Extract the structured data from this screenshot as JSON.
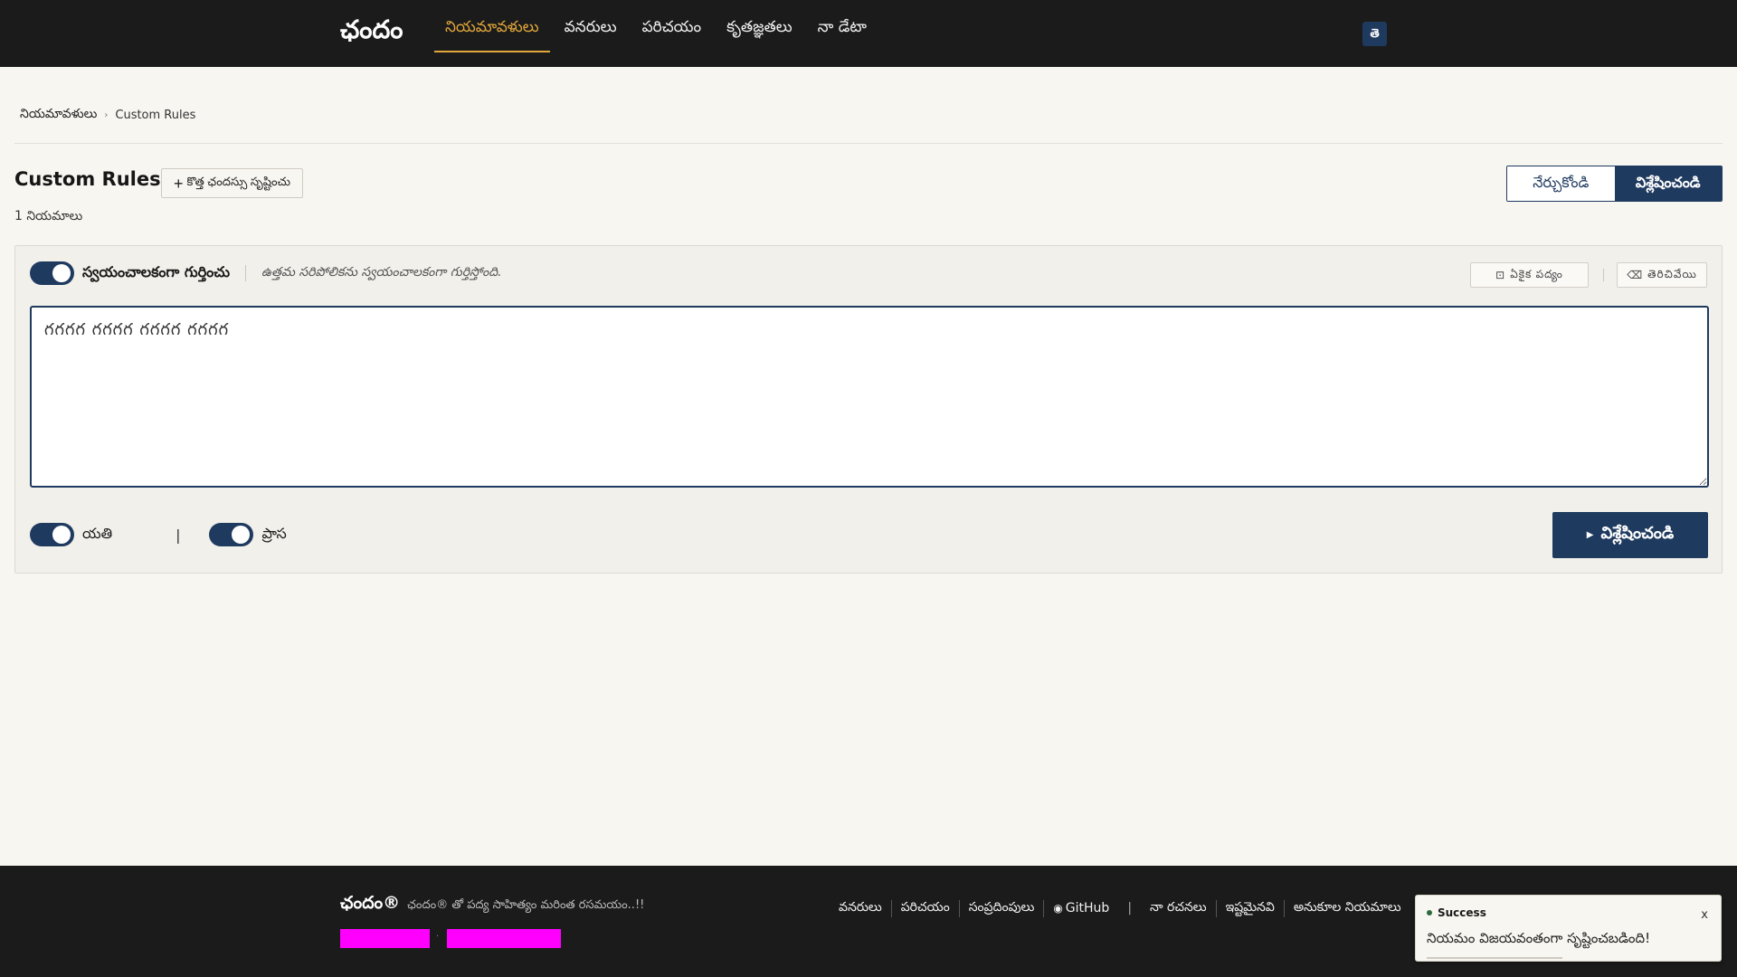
{
  "header": {
    "brand": "ఛందం",
    "nav": [
      {
        "label": "నియమావళులు",
        "active": true
      },
      {
        "label": "వనరులు",
        "active": false
      },
      {
        "label": "పరిచయం",
        "active": false
      },
      {
        "label": "కృతజ్ఞతలు",
        "active": false
      },
      {
        "label": "నా డేటా",
        "active": false
      }
    ],
    "lang_button": "తె"
  },
  "breadcrumb": {
    "root": "నియమావళులు",
    "current": "Custom Rules"
  },
  "page": {
    "title": "Custom Rules",
    "create_button": "కొత్త ఛందస్సు సృష్టించు",
    "rule_count": "1 నియమాలు",
    "modes": {
      "learn": "నేర్చుకోండి",
      "analyze": "విశ్లేషించండి",
      "active": "analyze"
    }
  },
  "analyzer": {
    "auto_detect_label": "స్వయంచాలకంగా గుర్తించు",
    "auto_detect_on": true,
    "auto_detect_hint": "ఉత్తమ సరిపోలికను స్వయంచాలకంగా గుర్తిస్తోంది.",
    "tool_one": "ఏకైక పద్యం",
    "tool_two": "తెరిచివేయి",
    "poem_text": "గగగగ గగగగ గగగగ గగగగ",
    "yati_label": "యతి",
    "yati_on": true,
    "prasa_label": "ప్రాస",
    "prasa_on": true,
    "separator": "|",
    "analyze_button": "విశ్లేషించండి"
  },
  "footer": {
    "brand": "ఛందం®",
    "tagline": "ఛందం® తో పద్య సాహిత్యం మరింత రసమయం..!!",
    "links": [
      "వనరులు",
      "పరిచయం",
      "సంప్రదింపులు",
      "GitHub"
    ],
    "separator": "|",
    "links_right": [
      "నా రచనలు",
      "ఇష్టమైనవి",
      "అనుకూల నియమాలు"
    ]
  },
  "toast": {
    "title": "Success",
    "message": "నియమం విజయవంతంగా సృష్టించబడింది!",
    "close": "x"
  },
  "colors": {
    "accent": "#1f3a5f",
    "active_nav": "#e2a73a",
    "header_bg": "#1b1b1b",
    "page_bg": "#f8f6f1",
    "placeholder_bar": "#ff00ff"
  }
}
